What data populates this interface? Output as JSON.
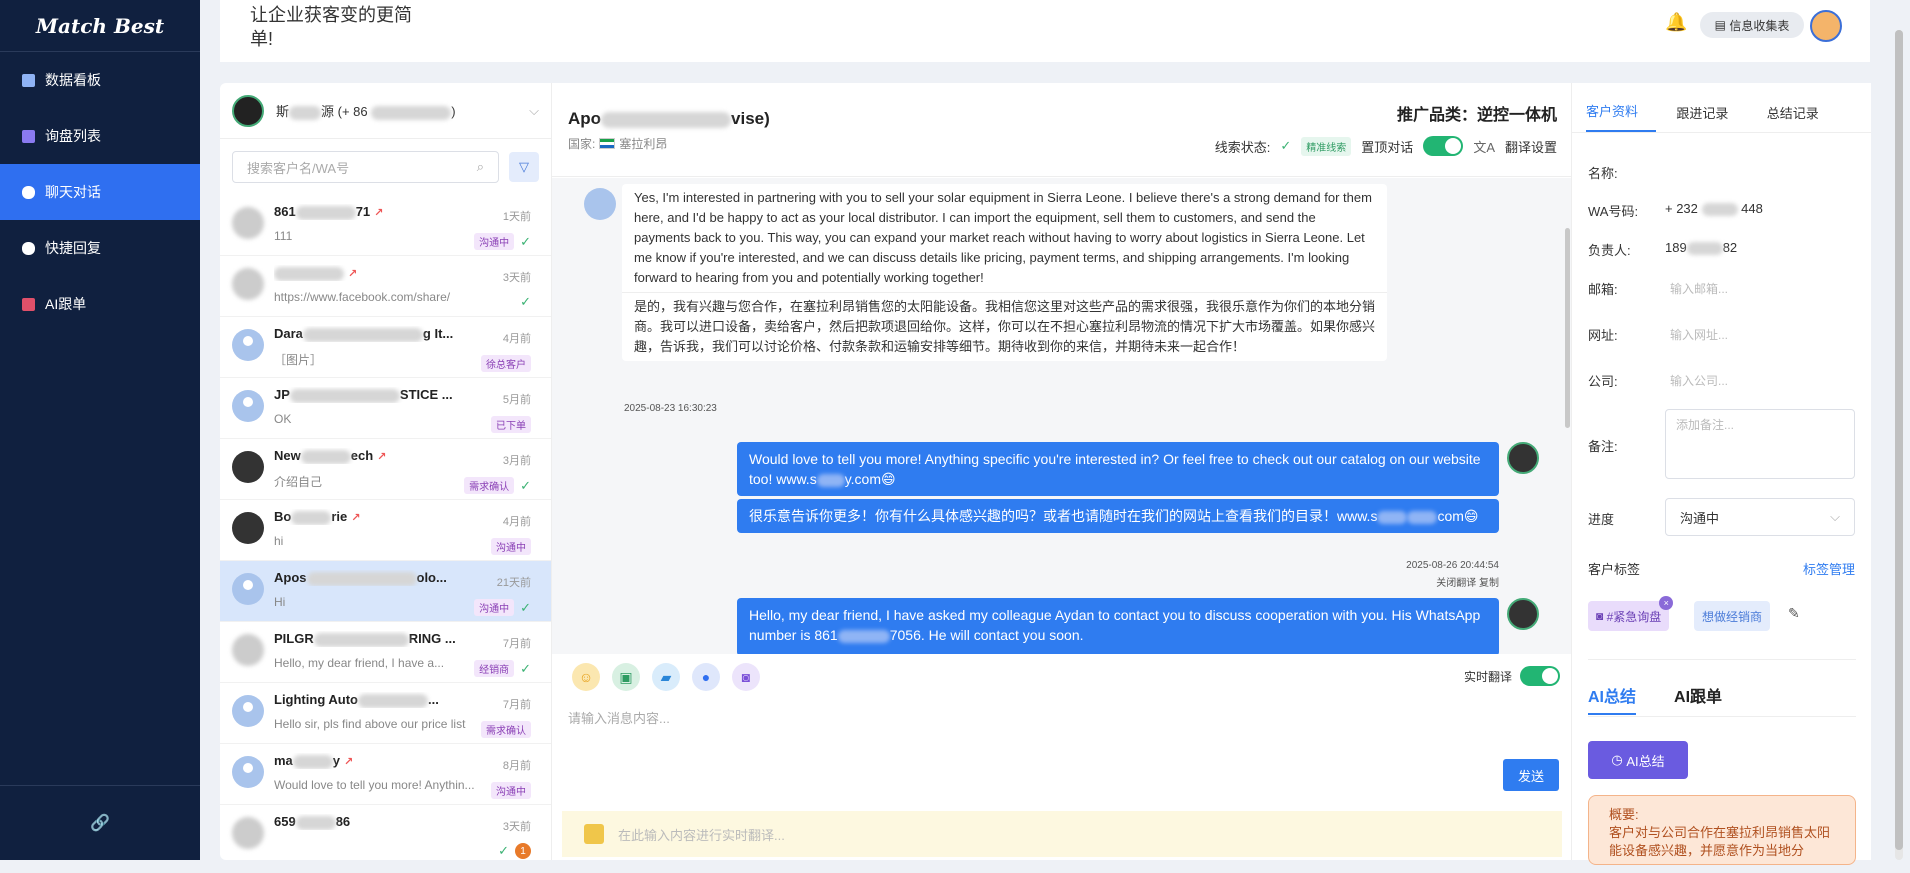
{
  "app": {
    "logo": "Match Best",
    "slogan": "让企业获客变的更简单!",
    "info_button": "信息收集表"
  },
  "sidebar": {
    "items": [
      {
        "label": "数据看板",
        "icon": "dashboard-icon"
      },
      {
        "label": "询盘列表",
        "icon": "inquiry-icon"
      },
      {
        "label": "聊天对话",
        "icon": "chat-icon",
        "active": true
      },
      {
        "label": "快捷回复",
        "icon": "quick-reply-icon"
      },
      {
        "label": "AI跟单",
        "icon": "ai-followup-icon"
      }
    ],
    "footer_icon": "link-icon"
  },
  "contacts_panel": {
    "account_name": "斯",
    "account_mid": "源 (+ 86",
    "account_tail": ")",
    "search_placeholder": "搜索客户名/WA号",
    "contacts": [
      {
        "name_pre": "861",
        "name_post": "71",
        "time": "1天前",
        "msg": "111",
        "tag": "沟通中",
        "check": true
      },
      {
        "name_pre": "",
        "name_post": "",
        "time": "3天前",
        "msg": "https://www.facebook.com/share/",
        "tag": "",
        "check": true
      },
      {
        "name_pre": "Dara",
        "name_post": "g It...",
        "time": "4月前",
        "msg": "［图片］",
        "tag": "徐总客户",
        "check": false
      },
      {
        "name_pre": "JP",
        "name_post": "STICE ...",
        "time": "5月前",
        "msg": "OK",
        "tag": "已下单",
        "check": false
      },
      {
        "name_pre": "New",
        "name_post": "ech",
        "time": "3月前",
        "msg": "介绍自己",
        "tag": "需求确认",
        "check": true
      },
      {
        "name_pre": "Bo",
        "name_post": "rie",
        "time": "4月前",
        "msg": "hi",
        "tag": "沟通中",
        "check": false
      },
      {
        "name_pre": "Apos",
        "name_post": "olo...",
        "time": "21天前",
        "msg": "Hi",
        "tag": "沟通中",
        "check": true
      },
      {
        "name_pre": "PILGR",
        "name_post": "RING ...",
        "time": "7月前",
        "msg": "Hello, my dear friend, I have a...",
        "tag": "经销商",
        "check": true
      },
      {
        "name_pre": "Lighting Auto",
        "name_post": "...",
        "time": "7月前",
        "msg": "Hello sir, pls find above our price list",
        "tag": "需求确认",
        "check": false
      },
      {
        "name_pre": "ma",
        "name_post": "y",
        "time": "8月前",
        "msg": "Would love to tell you more! Anythin...",
        "tag": "沟通中",
        "check": false
      },
      {
        "name_pre": "659",
        "name_post": "86",
        "time": "3天前",
        "msg": "",
        "tag": "",
        "check": true,
        "badge": "1"
      }
    ]
  },
  "chat": {
    "name_pre": "Apo",
    "name_post": "vise)",
    "country_label": "国家:",
    "country": "塞拉利昂",
    "category": "推广品类：逆控一体机",
    "lead_status_label": "线索状态:",
    "lead_tag": "精准线索",
    "pin_label": "置顶对话",
    "translate_settings": "翻译设置",
    "messages": {
      "incoming_en": "Yes, I'm interested in partnering with you to sell your solar equipment in Sierra Leone. I believe there's a strong demand for them here, and I'd be happy to act as your local distributor. I can import the equipment, sell them to customers, and send the payments back to you. This way, you can expand your market reach without having to worry about logistics in Sierra Leone. Let me know if you're interested, and we can discuss details like pricing, payment terms, and shipping arrangements. I'm looking forward to hearing from you and potentially working together!",
      "incoming_zh": "是的，我有兴趣与您合作，在塞拉利昂销售您的太阳能设备。我相信您这里对这些产品的需求很强，我很乐意作为你们的本地分销商。我可以进口设备，卖给客户，然后把款项退回给你。这样，你可以在不担心塞拉利昂物流的情况下扩大市场覆盖。如果你感兴趣，告诉我，我们可以讨论价格、付款条款和运输安排等细节。期待收到你的来信，并期待未来一起合作！",
      "incoming_time": "2025-08-23 16:30:23",
      "out1_en_pre": "Would love to tell you more! Anything specific you're interested in? Or feel free to check out our catalog on our website too! www.s",
      "out1_en_post": "y.com😄",
      "out1_zh_pre": "很乐意告诉你更多！你有什么具体感兴趣的吗？或者也请随时在我们的网站上查看我们的目录！www.s",
      "out1_zh_post": "com😄",
      "out1_time": "2025-08-26 20:44:54",
      "out1_actions": "关闭翻译  复制",
      "out2_pre": "Hello, my dear friend, I have asked my colleague Aydan to contact you to discuss cooperation with you. His WhatsApp number is 861",
      "out2_post": "7056. He will contact you soon."
    },
    "realtime_translate": "实时翻译",
    "input_placeholder": "请输入消息内容...",
    "send": "发送",
    "translate_placeholder": "在此输入内容进行实时翻译..."
  },
  "customer": {
    "tabs": [
      "客户资料",
      "跟进记录",
      "总结记录"
    ],
    "fields": {
      "name_label": "名称:",
      "wa_label": "WA号码:",
      "wa_pre": "+ 232",
      "wa_post": "448",
      "owner_label": "负责人:",
      "owner_pre": "189",
      "owner_post": "82",
      "email_label": "邮箱:",
      "email_ph": "输入邮箱...",
      "site_label": "网址:",
      "site_ph": "输入网址...",
      "company_label": "公司:",
      "company_ph": "输入公司...",
      "note_label": "备注:",
      "note_ph": "添加备注...",
      "progress_label": "进度",
      "progress_value": "沟通中",
      "tags_label": "客户标签",
      "tags_manage": "标签管理",
      "tag1": "#紧急询盘",
      "tag2": "想做经销商"
    },
    "ai_tabs": [
      "AI总结",
      "AI跟单"
    ],
    "ai_button": "AI总结",
    "summary_title": "概要:",
    "summary_text": "客户对与公司合作在塞拉利昂销售太阳能设备感兴趣，并愿意作为当地分"
  },
  "colors": {
    "sidebar": "#10203f",
    "accent": "#2f7cf0",
    "active_nav": "#2f6ff0",
    "success": "#22b573"
  }
}
